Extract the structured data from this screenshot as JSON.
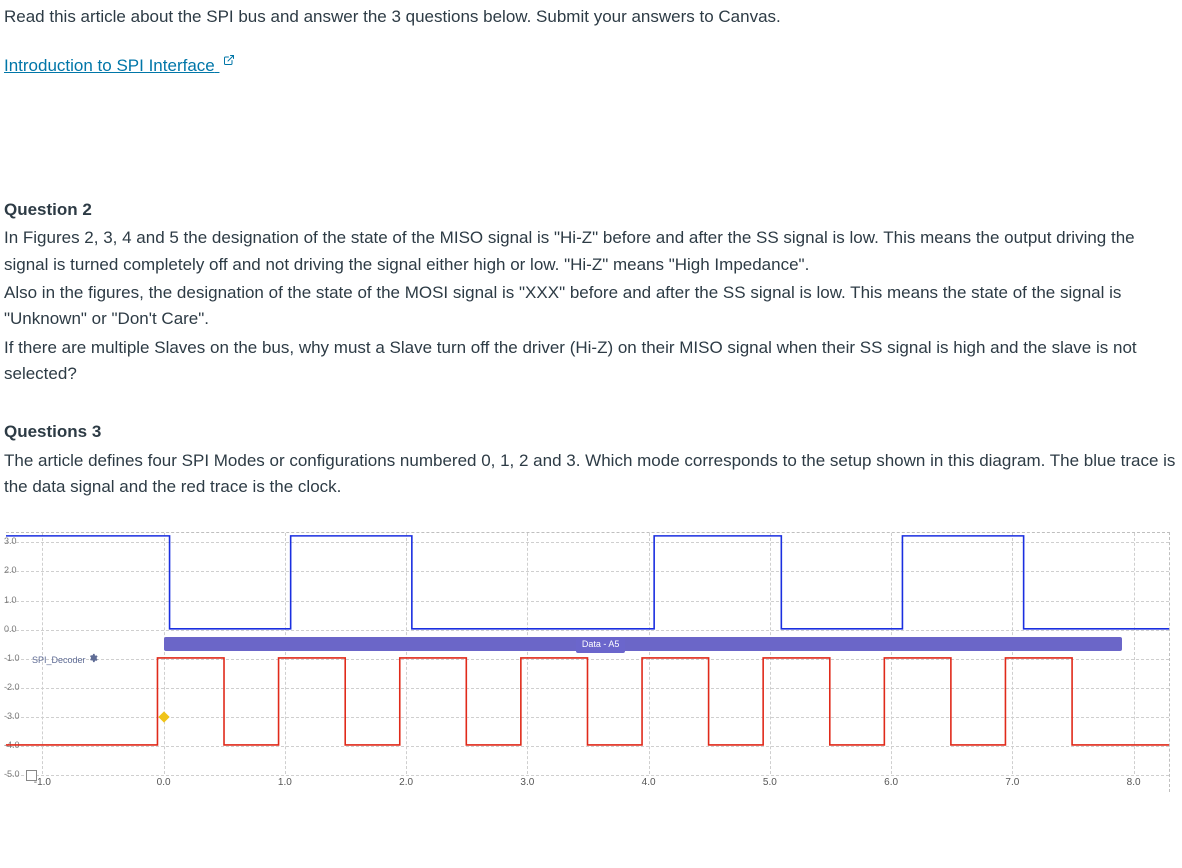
{
  "intro_text": "Read this article about the SPI bus and answer the 3 questions below. Submit your answers to Canvas.",
  "link_text": "Introduction to SPI Interface",
  "question2": {
    "heading": "Question 2",
    "para1": "In Figures 2, 3, 4 and 5 the designation of the state of the MISO signal is \"Hi-Z\" before and after the SS signal is low. This means the output driving the signal is turned completely off and not driving the signal either high or low. \"Hi-Z\" means \"High Impedance\".",
    "para2": "Also in the figures, the designation of the state of the MOSI signal is \"XXX\" before and after the SS signal is low. This means the state of the signal is \"Unknown\" or \"Don't Care\".",
    "para3": "If there are multiple Slaves on the bus, why must a Slave turn off the driver (Hi-Z) on their MISO signal when their SS signal is high and the slave is not selected?"
  },
  "question3": {
    "heading": "Questions 3",
    "para1": "The article defines four SPI Modes or configurations numbered 0, 1, 2 and 3. Which mode corresponds to the setup shown in this diagram. The blue trace is the data signal and the red trace is the clock."
  },
  "chart_data": {
    "type": "line",
    "xlabel": "",
    "ylabel": "",
    "x_ticks": [
      -1.0,
      0.0,
      1.0,
      2.0,
      3.0,
      4.0,
      5.0,
      6.0,
      7.0,
      8.0
    ],
    "y_ticks": [
      3.0,
      2.0,
      1.0,
      0.0,
      -1.0,
      -2.0,
      -3.0,
      -4.0,
      -5.0
    ],
    "y_range": [
      -5.0,
      3.3
    ],
    "x_range": [
      -1.3,
      8.3
    ],
    "decoder_label": "SPI_Decoder",
    "decoder_band_text": "Data - A5",
    "series": [
      {
        "name": "data-blue",
        "color": "#1a2fe0",
        "level_high": 3.2,
        "level_low": 0.0,
        "transitions": [
          {
            "x": -1.3,
            "lvl": "high"
          },
          {
            "x": 0.05,
            "lvl": "low"
          },
          {
            "x": 1.05,
            "lvl": "high"
          },
          {
            "x": 2.05,
            "lvl": "low"
          },
          {
            "x": 4.05,
            "lvl": "high"
          },
          {
            "x": 5.1,
            "lvl": "low"
          },
          {
            "x": 6.1,
            "lvl": "high"
          },
          {
            "x": 7.1,
            "lvl": "low"
          },
          {
            "x": 8.3,
            "lvl": "low"
          }
        ]
      },
      {
        "name": "clock-red",
        "color": "#e02a1a",
        "level_high": -1.0,
        "level_low": -4.0,
        "transitions": [
          {
            "x": -1.3,
            "lvl": "low"
          },
          {
            "x": -0.05,
            "lvl": "high"
          },
          {
            "x": 0.5,
            "lvl": "low"
          },
          {
            "x": 0.95,
            "lvl": "high"
          },
          {
            "x": 1.5,
            "lvl": "low"
          },
          {
            "x": 1.95,
            "lvl": "high"
          },
          {
            "x": 2.5,
            "lvl": "low"
          },
          {
            "x": 2.95,
            "lvl": "high"
          },
          {
            "x": 3.5,
            "lvl": "low"
          },
          {
            "x": 3.95,
            "lvl": "high"
          },
          {
            "x": 4.5,
            "lvl": "low"
          },
          {
            "x": 4.95,
            "lvl": "high"
          },
          {
            "x": 5.5,
            "lvl": "low"
          },
          {
            "x": 5.95,
            "lvl": "high"
          },
          {
            "x": 6.5,
            "lvl": "low"
          },
          {
            "x": 6.95,
            "lvl": "high"
          },
          {
            "x": 7.5,
            "lvl": "low"
          },
          {
            "x": 8.3,
            "lvl": "low"
          }
        ]
      }
    ],
    "decoder_band": {
      "x_start": 0.0,
      "x_end": 7.9,
      "y": -0.5
    }
  }
}
